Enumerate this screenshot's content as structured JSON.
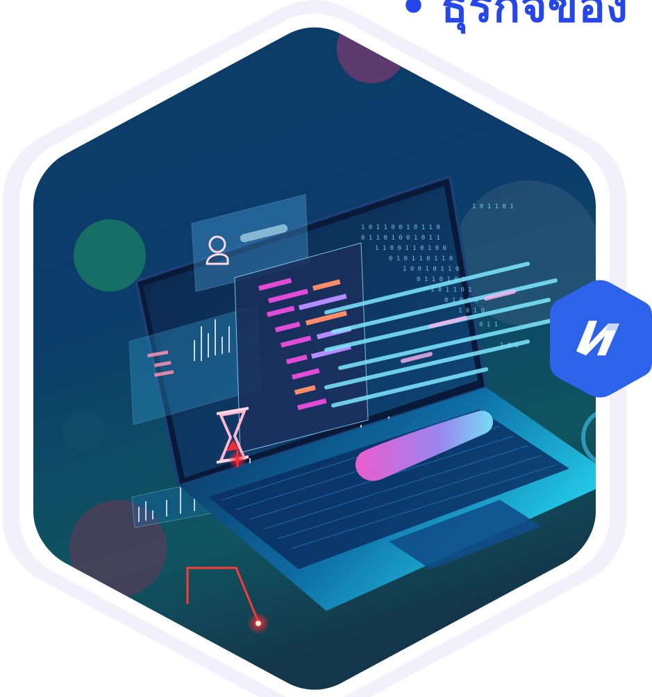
{
  "heading": {
    "bullet": "•",
    "text": "ธุรกิจของ"
  },
  "illustration": {
    "subject": "laptop-hologram-code",
    "icon": "hourglass-icon"
  },
  "badge": {
    "icon": "n-logo-icon"
  },
  "colors": {
    "heading": "#2546e8",
    "ring": "#f1f0fb",
    "badge": "#2d63ea",
    "neon_cyan": "#2fe3ff",
    "neon_pink": "#e24bd8",
    "neon_red": "#ff2a36"
  }
}
